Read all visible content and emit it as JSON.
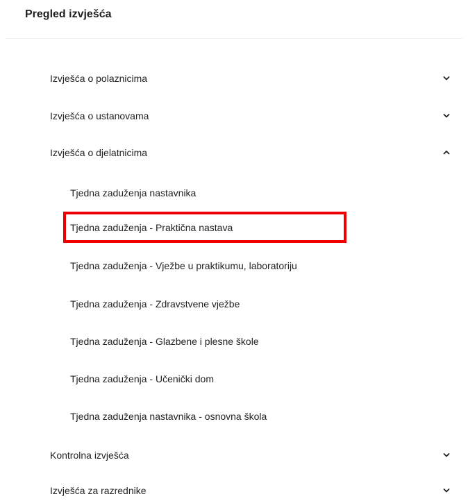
{
  "header": {
    "title": "Pregled izvješća"
  },
  "sections": [
    {
      "label": "Izvješća o polaznicima",
      "expanded": false,
      "icon": "chevron-down-icon"
    },
    {
      "label": "Izvješća o ustanovama",
      "expanded": false,
      "icon": "chevron-down-icon"
    },
    {
      "label": "Izvješća o djelatnicima",
      "expanded": true,
      "icon": "chevron-up-icon"
    },
    {
      "label": "Kontrolna izvješća",
      "expanded": false,
      "icon": "chevron-down-icon"
    },
    {
      "label": "Izvješća za razrednike",
      "expanded": false,
      "icon": "chevron-down-icon"
    }
  ],
  "djelatnici_items": [
    {
      "label": "Tjedna zaduženja nastavnika"
    },
    {
      "label": "Tjedna zaduženja - Praktična nastava",
      "highlighted": true
    },
    {
      "label": "Tjedna zaduženja - Vježbe u praktikumu, laboratoriju"
    },
    {
      "label": "Tjedna zaduženja - Zdravstvene vježbe"
    },
    {
      "label": "Tjedna zaduženja - Glazbene i plesne škole"
    },
    {
      "label": "Tjedna zaduženja - Učenički dom"
    },
    {
      "label": "Tjedna zaduženja nastavnika - osnovna škola"
    }
  ],
  "colors": {
    "highlight": "#ee0000"
  }
}
